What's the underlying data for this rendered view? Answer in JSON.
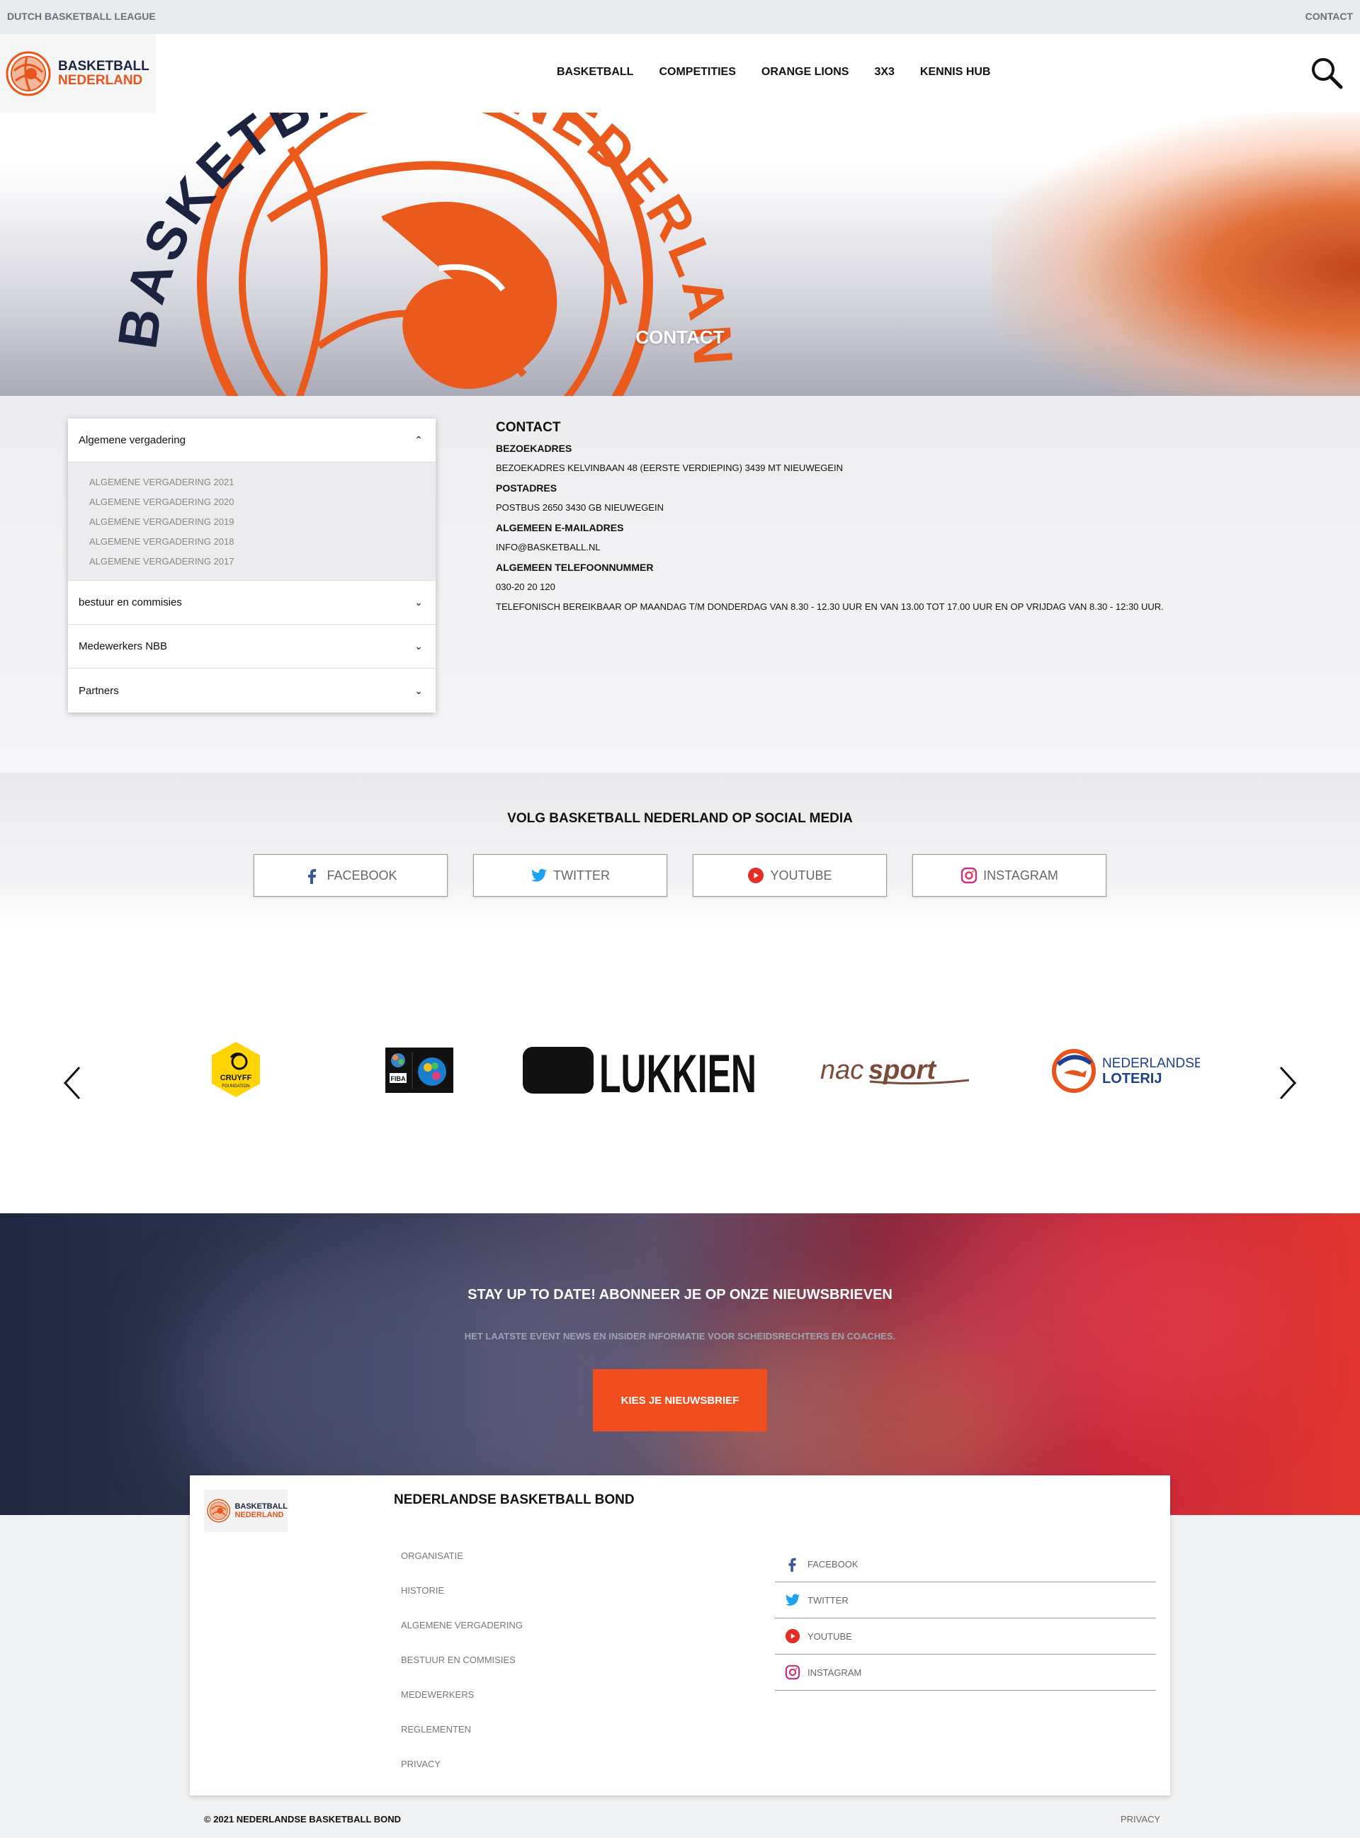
{
  "topbar": {
    "left": "DUTCH BASKETBALL LEAGUE",
    "right": "CONTACT"
  },
  "logo": {
    "line1": "BASKETBALL",
    "line2": "NEDERLAND"
  },
  "nav": [
    "BASKETBALL",
    "COMPETITIES",
    "ORANGE LIONS",
    "3X3",
    "KENNIS HUB"
  ],
  "hero": {
    "title": "CONTACT",
    "emblem_text": [
      "BASKETBALL",
      "NEDERLAND"
    ]
  },
  "accordion": {
    "open_title": "Algemene vergadering",
    "open_items": [
      "ALGEMENE VERGADERING 2021",
      "ALGEMENE VERGADERING 2020",
      "ALGEMENE VERGADERING 2019",
      "ALGEMENE VERGADERING 2018",
      "ALGEMENE VERGADERING 2017"
    ],
    "closed": [
      "bestuur en commisies",
      "Medewerkers NBB",
      "Partners"
    ]
  },
  "contact": {
    "title": "CONTACT",
    "bezoek_label": "BEZOEKADRES",
    "bezoek_text": "BEZOEKADRES KELVINBAAN 48 (EERSTE VERDIEPING) 3439 MT NIEUWEGEIN",
    "post_label": "POSTADRES",
    "post_text": "POSTBUS 2650 3430 GB NIEUWEGEIN",
    "email_label": "ALGEMEEN E-MAILADRES",
    "email_text": "INFO@BASKETBALL.NL",
    "phone_label": "ALGEMEEN TELEFOONNUMMER",
    "phone_text": "030-20 20 120",
    "hours_text": "TELEFONISCH BEREIKBAAR OP MAANDAG T/M DONDERDAG VAN 8.30 - 12.30 UUR EN VAN 13.00 TOT 17.00 UUR EN OP VRIJDAG VAN 8.30 - 12:30 UUR."
  },
  "social": {
    "title": "VOLG BASKETBALL NEDERLAND OP SOCIAL MEDIA",
    "buttons": [
      "FACEBOOK",
      "TWITTER",
      "YOUTUBE",
      "INSTAGRAM"
    ]
  },
  "partners": {
    "cruyff": {
      "line1": "CRUYFF",
      "line2": "FOUNDATION"
    },
    "fiba": "FIBA",
    "lukkien": "LUKKIEN",
    "nacsport": {
      "a": "nac",
      "b": "sport"
    },
    "loterij": {
      "line1": "NEDERLANDSE",
      "line2": "LOTERIJ"
    }
  },
  "newsletter": {
    "title": "STAY UP TO DATE! ABONNEER JE OP ONZE NIEUWSBRIEVEN",
    "subtitle": "HET LAATSTE EVENT NEWS EN INSIDER INFORMATIE VOOR SCHEIDSRECHTERS EN COACHES.",
    "button": "KIES JE NIEUWSBRIEF"
  },
  "footer": {
    "title": "NEDERLANDSE BASKETBALL BOND",
    "links": [
      "ORGANISATIE",
      "HISTORIE",
      "ALGEMENE VERGADERING",
      "BESTUUR EN COMMISIES",
      "MEDEWERKERS",
      "REGLEMENTEN",
      "PRIVACY"
    ],
    "social": [
      "FACEBOOK",
      "TWITTER",
      "YOUTUBE",
      "INSTAGRAM"
    ],
    "copyright": "© 2021 NEDERLANDSE BASKETBALL BOND",
    "privacy": "PRIVACY"
  },
  "colors": {
    "brand_orange": "#e8541b",
    "brand_navy": "#1c2340",
    "cta": "#f04e1e"
  }
}
